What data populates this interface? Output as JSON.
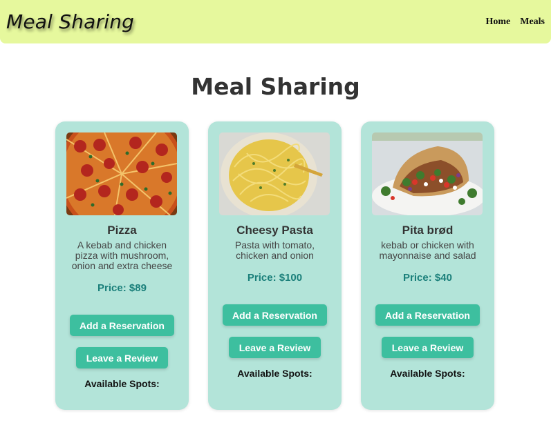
{
  "header": {
    "brand": "Meal Sharing",
    "nav": [
      {
        "label": "Home"
      },
      {
        "label": "Meals"
      }
    ]
  },
  "page": {
    "title": "Meal Sharing"
  },
  "meals": [
    {
      "name": "Pizza",
      "description": "A kebab and chicken pizza with mushroom, onion and extra cheese",
      "price": "Price: $89",
      "reserve_label": "Add a Reservation",
      "review_label": "Leave a Review",
      "spots_label": "Available Spots:"
    },
    {
      "name": "Cheesy Pasta",
      "description": "Pasta with tomato, chicken and onion",
      "price": "Price: $100",
      "reserve_label": "Add a Reservation",
      "review_label": "Leave a Review",
      "spots_label": "Available Spots:"
    },
    {
      "name": "Pita brød",
      "description": "kebab or chicken with mayonnaise and salad",
      "price": "Price: $40",
      "reserve_label": "Add a Reservation",
      "review_label": "Leave a Review",
      "spots_label": "Available Spots:"
    }
  ],
  "colors": {
    "navbar": "#e6f89d",
    "card": "#b3e4d9",
    "button": "#3dbf9f",
    "price": "#1a7f7a"
  }
}
